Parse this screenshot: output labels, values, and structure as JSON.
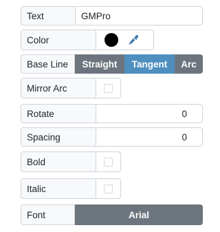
{
  "text_row": {
    "label": "Text",
    "value": "GMPro"
  },
  "color_row": {
    "label": "Color",
    "swatch_color": "#000000",
    "picker_icon": "eyedropper-icon",
    "picker_color": "#3d7ab5"
  },
  "baseline_row": {
    "label": "Base Line",
    "options": [
      "Straight",
      "Tangent",
      "Arc"
    ],
    "selected": "Tangent"
  },
  "mirror_row": {
    "label": "Mirror Arc",
    "checked": false
  },
  "rotate_row": {
    "label": "Rotate",
    "value": "0"
  },
  "spacing_row": {
    "label": "Spacing",
    "value": "0"
  },
  "bold_row": {
    "label": "Bold",
    "checked": false
  },
  "italic_row": {
    "label": "Italic",
    "checked": false
  },
  "font_row": {
    "label": "Font",
    "value": "Arial"
  },
  "colors": {
    "segment_bg": "#6c757d",
    "segment_active": "#4e8fc0",
    "label_bg": "#f8f9fa",
    "border": "#ced4da"
  }
}
